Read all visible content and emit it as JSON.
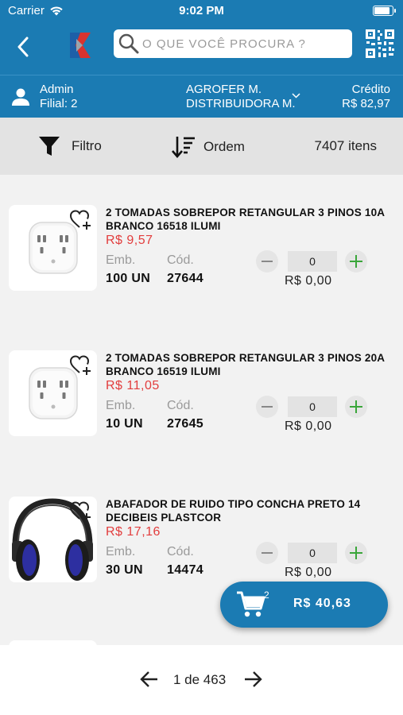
{
  "status_bar": {
    "carrier": "Carrier",
    "time": "9:02 PM"
  },
  "header": {
    "search_placeholder": "O QUE VOCÊ PROCURA ?"
  },
  "user_bar": {
    "user_name": "Admin",
    "branch": "Filial: 2",
    "company_line1": "AGROFER M.",
    "company_line2": "DISTRIBUIDORA M.",
    "credit_label": "Crédito",
    "credit_value": "R$  82,97"
  },
  "toolbar": {
    "filter_label": "Filtro",
    "order_label": "Ordem",
    "item_count": "7407 itens"
  },
  "products": [
    {
      "name": "2 TOMADAS SOBREPOR RETANGULAR 3 PINOS 10A BRANCO 16518 ILUMI",
      "price": "R$  9,57",
      "emb_label": "Emb.",
      "emb_value": "100 UN",
      "cod_label": "Cód.",
      "cod_value": "27644",
      "quantity": "0",
      "subtotal": "R$  0,00",
      "image": "outlet"
    },
    {
      "name": "2 TOMADAS SOBREPOR RETANGULAR 3 PINOS 20A BRANCO 16519 ILUMI",
      "price": "R$  11,05",
      "emb_label": "Emb.",
      "emb_value": "10 UN",
      "cod_label": "Cód.",
      "cod_value": "27645",
      "quantity": "0",
      "subtotal": "R$  0,00",
      "image": "outlet"
    },
    {
      "name": "ABAFADOR DE RUIDO TIPO CONCHA PRETO 14 DECIBEIS PLASTCOR",
      "price": "R$  17,16",
      "emb_label": "Emb.",
      "emb_value": "30 UN",
      "cod_label": "Cód.",
      "cod_value": "14474",
      "quantity": "0",
      "subtotal": "R$  0,00",
      "image": "earmuffs"
    }
  ],
  "cart": {
    "badge_count": "2",
    "total": "R$  40,63"
  },
  "pagination": {
    "label": "1 de 463"
  },
  "colors": {
    "primary": "#1b7bb3",
    "price": "#e23d3d",
    "plus": "#3aa63a"
  }
}
